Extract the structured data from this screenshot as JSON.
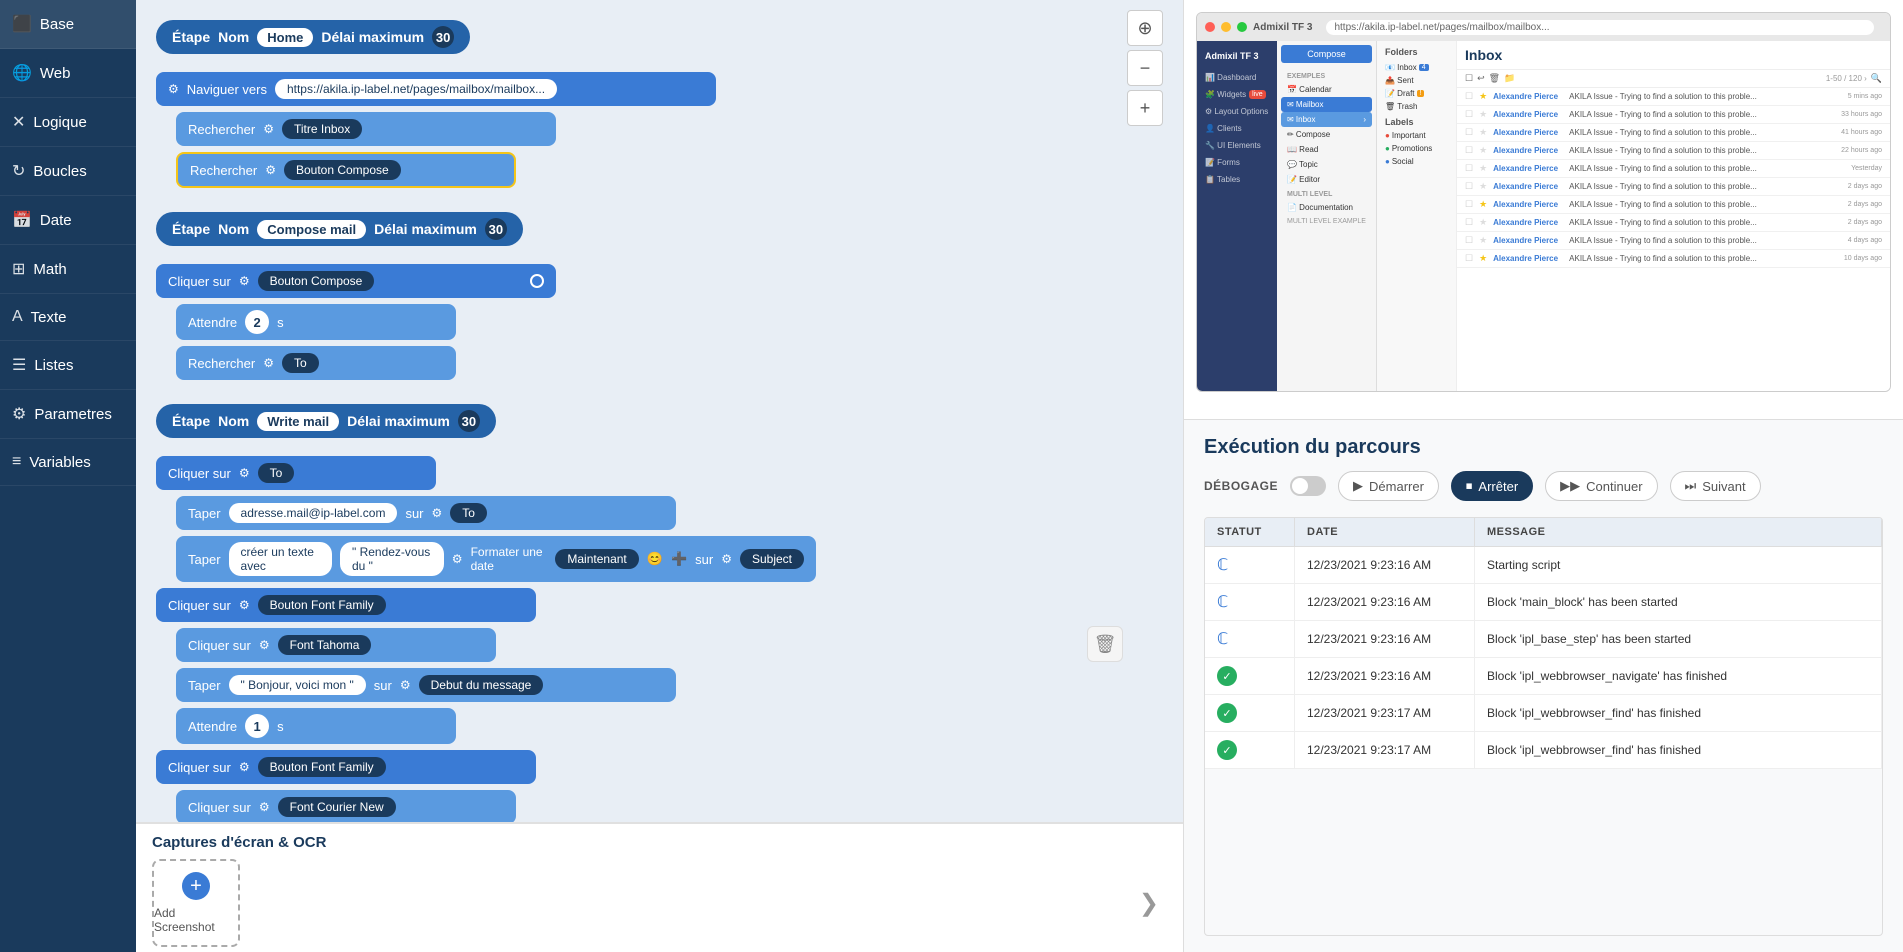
{
  "sidebar": {
    "items": [
      {
        "id": "base",
        "label": "Base",
        "icon": "⬛",
        "active": false
      },
      {
        "id": "web",
        "label": "Web",
        "icon": "🌐",
        "active": false
      },
      {
        "id": "logique",
        "label": "Logique",
        "icon": "✕",
        "active": false
      },
      {
        "id": "boucles",
        "label": "Boucles",
        "icon": "↻",
        "active": false
      },
      {
        "id": "date",
        "label": "Date",
        "icon": "📅",
        "active": false
      },
      {
        "id": "math",
        "label": "Math",
        "icon": "⊞",
        "active": false
      },
      {
        "id": "texte",
        "label": "Texte",
        "icon": "A",
        "active": false
      },
      {
        "id": "listes",
        "label": "Listes",
        "icon": "☰",
        "active": false
      },
      {
        "id": "parametres",
        "label": "Parametres",
        "icon": "⚙",
        "active": false
      },
      {
        "id": "variables",
        "label": "Variables",
        "icon": "≡",
        "active": false
      }
    ]
  },
  "script": {
    "step1": {
      "label": "Étape",
      "name_label": "Nom",
      "name_value": "Home",
      "delai_label": "Délai maximum",
      "delai_value": "30",
      "blocks": [
        {
          "action": "Naviguer vers",
          "value": "https://akila.ip-label.net/pages/mailbox/mailbox..."
        },
        {
          "action": "Rechercher",
          "gear": true,
          "pill": "Titre Inbox"
        },
        {
          "action": "Rechercher",
          "gear": true,
          "pill": "Bouton Compose",
          "highlighted": true
        }
      ]
    },
    "step2": {
      "label": "Étape",
      "name_label": "Nom",
      "name_value": "Compose mail",
      "delai_label": "Délai maximum",
      "delai_value": "30",
      "blocks": [
        {
          "action": "Cliquer sur",
          "gear": true,
          "pill": "Bouton Compose"
        },
        {
          "action": "Attendre",
          "value": "2",
          "unit": "s"
        },
        {
          "action": "Rechercher",
          "gear": true,
          "pill": "To"
        }
      ]
    },
    "step3": {
      "label": "Étape",
      "name_label": "Nom",
      "name_value": "Write mail",
      "delai_label": "Délai maximum",
      "delai_value": "30",
      "blocks": [
        {
          "action": "Cliquer sur",
          "gear": true,
          "pill": "To"
        },
        {
          "action": "Taper",
          "value": "adresse.mail@ip-label.com",
          "sur": "sur",
          "pill": "To"
        },
        {
          "action": "Taper",
          "text": "créer un texte avec",
          "quote": "Rendez-vous du",
          "extra": "Formater une date Maintenant 😊 ➕ sur ⚙ Subject"
        },
        {
          "action": "Cliquer sur",
          "gear": true,
          "pill": "Bouton Font Family"
        },
        {
          "action": "Cliquer sur",
          "gear": true,
          "pill": "Font Tahoma"
        },
        {
          "action": "Taper",
          "value": "Bonjour, voici mon",
          "sur": "sur",
          "pill": "Debut du message"
        },
        {
          "action": "Attendre",
          "value": "1",
          "unit": "s"
        },
        {
          "action": "Cliquer sur",
          "gear": true,
          "pill": "Bouton Font Family"
        },
        {
          "action": "Cliquer sur",
          "gear": true,
          "pill": "Font Courier New"
        }
      ]
    }
  },
  "screenshot_section": {
    "title": "Captures d'écran & OCR",
    "add_button_label": "Add Screenshot",
    "nav_arrow": "❯"
  },
  "browser": {
    "title": "Admixil TF 3",
    "address": "https://akila.ip-label.net/pages/mailbox/mailbox...",
    "inbox_title": "Inbox",
    "compose_btn": "Compose",
    "sidebar_items": [
      "Dashboard",
      "Widgets",
      "Layout Options",
      "Clients",
      "UI Elements",
      "Forms",
      "Tables"
    ],
    "nav_sections": [
      {
        "label": "EXEMPLES",
        "items": [
          "Calendar",
          "Mailbox",
          "Inbox",
          "Compose",
          "Read",
          "Topic",
          "Editor"
        ]
      },
      {
        "label": "MULTI LEVEL",
        "items": [
          "Documentation"
        ]
      }
    ],
    "labels": [
      "Folders",
      "Inbox",
      "Sent",
      "Draft",
      "Trash",
      "Labels",
      "Important",
      "Promotions",
      "Social"
    ],
    "emails": [
      {
        "sender": "Alexandre Pierce",
        "subject": "AKILA Issue - Trying to find a solution to this proble...",
        "time": "5 mins ago",
        "star": true
      },
      {
        "sender": "Alexandre Pierce",
        "subject": "AKILA Issue - Trying to find a solution to this proble...",
        "time": "33 hours ago",
        "star": false
      },
      {
        "sender": "Alexandre Pierce",
        "subject": "AKILA Issue - Trying to find a solution to this proble...",
        "time": "41 hours ago",
        "star": false
      },
      {
        "sender": "Alexandre Pierce",
        "subject": "AKILA Issue - Trying to find a solution to this proble...",
        "time": "22 hours ago",
        "star": false
      },
      {
        "sender": "Alexandre Pierce",
        "subject": "AKILA Issue - Trying to find a solution to this proble...",
        "time": "Yesterday",
        "star": false
      },
      {
        "sender": "Alexandre Pierce",
        "subject": "AKILA Issue - Trying to find a solution to this proble...",
        "time": "2 days ago",
        "star": false
      },
      {
        "sender": "Alexandre Pierce",
        "subject": "AKILA Issue - Trying to find a solution to this proble...",
        "time": "2 days ago",
        "star": true
      },
      {
        "sender": "Alexandre Pierce",
        "subject": "AKILA Issue - Trying to find a solution to this proble...",
        "time": "2 days ago",
        "star": false
      },
      {
        "sender": "Alexandre Pierce",
        "subject": "AKILA Issue - Trying to find a solution to this proble...",
        "time": "4 days ago",
        "star": false
      },
      {
        "sender": "Alexandre Pierce",
        "subject": "AKILA Issue - Trying to find a solution to this proble...",
        "time": "10 days ago",
        "star": true
      }
    ]
  },
  "execution": {
    "title": "Exécution du parcours",
    "debug_label": "DÉBOGAGE",
    "buttons": {
      "start": "Démarrer",
      "stop": "Arrêter",
      "continue": "Continuer",
      "next": "Suivant"
    },
    "table": {
      "headers": [
        "STATUT",
        "DATE",
        "MESSAGE"
      ],
      "rows": [
        {
          "status": "loading",
          "date": "12/23/2021 9:23:16 AM",
          "message": "Starting script"
        },
        {
          "status": "loading",
          "date": "12/23/2021 9:23:16 AM",
          "message": "Block 'main_block' has been started"
        },
        {
          "status": "loading",
          "date": "12/23/2021 9:23:16 AM",
          "message": "Block 'ipl_base_step' has been started"
        },
        {
          "status": "success",
          "date": "12/23/2021 9:23:16 AM",
          "message": "Block 'ipl_webbrowser_navigate' has finished"
        },
        {
          "status": "success",
          "date": "12/23/2021 9:23:17 AM",
          "message": "Block 'ipl_webbrowser_find' has finished"
        },
        {
          "status": "success",
          "date": "12/23/2021 9:23:17 AM",
          "message": "Block 'ipl_webbrowser_find' has finished"
        }
      ]
    }
  }
}
